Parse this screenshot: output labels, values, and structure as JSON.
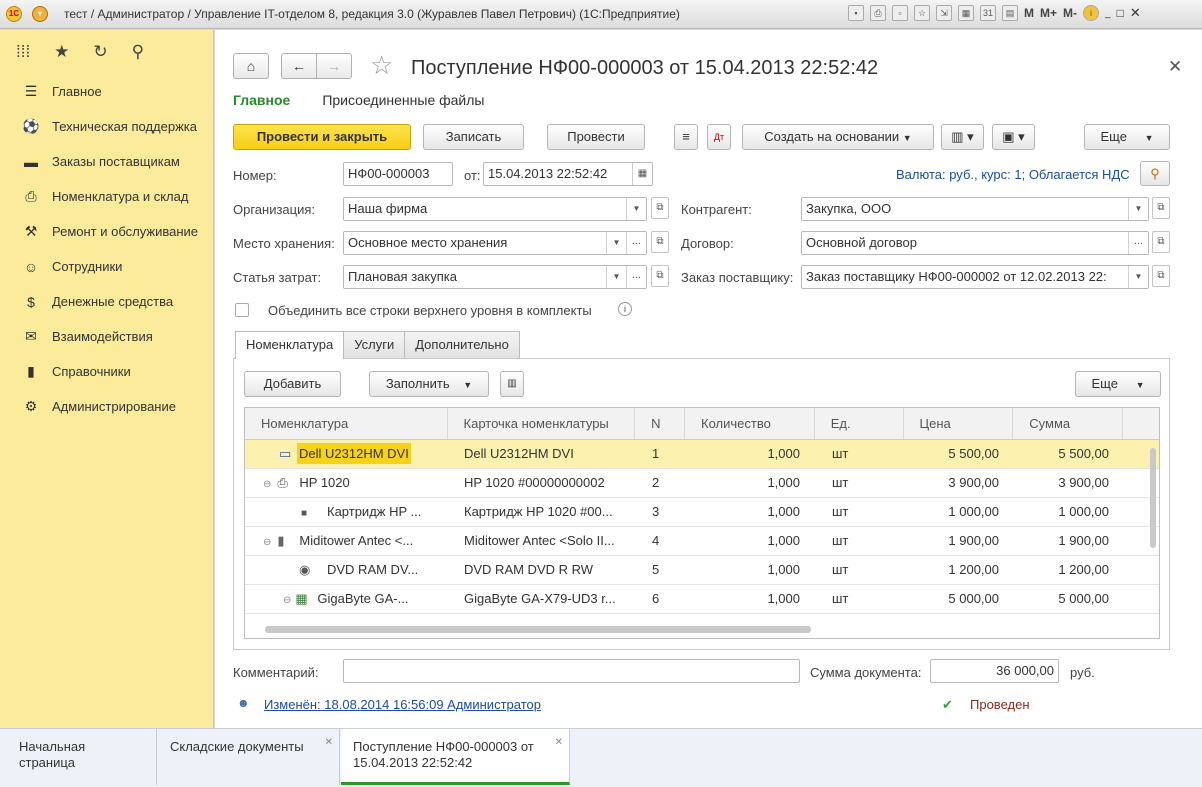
{
  "window": {
    "title": "тест / Администратор / Управление IT-отделом 8, редакция 3.0 (Журавлев Павел Петрович)  (1С:Предприятие)",
    "m_labels": [
      "M",
      "M+",
      "M-"
    ]
  },
  "sidebar": {
    "items": [
      {
        "label": "Главное",
        "icon": "menu-icon"
      },
      {
        "label": "Техническая поддержка",
        "icon": "support-icon"
      },
      {
        "label": "Заказы поставщикам",
        "icon": "truck-icon"
      },
      {
        "label": "Номенклатура и склад",
        "icon": "printer-icon"
      },
      {
        "label": "Ремонт и обслуживание",
        "icon": "wrench-icon"
      },
      {
        "label": "Сотрудники",
        "icon": "users-icon"
      },
      {
        "label": "Денежные средства",
        "icon": "money-icon"
      },
      {
        "label": "Взаимодействия",
        "icon": "envelope-icon"
      },
      {
        "label": "Справочники",
        "icon": "book-icon"
      },
      {
        "label": "Администрирование",
        "icon": "gear-icon"
      }
    ]
  },
  "document": {
    "title": "Поступление НФ00-000003 от 15.04.2013 22:52:42",
    "tabs": [
      "Главное",
      "Присоединенные файлы"
    ]
  },
  "toolbar": {
    "post_close": "Провести и закрыть",
    "save": "Записать",
    "post": "Провести",
    "create_based": "Создать на основании",
    "more": "Еще"
  },
  "form": {
    "number_label": "Номер:",
    "number_value": "НФ00-000003",
    "date_label": "от:",
    "date_value": "15.04.2013 22:52:42",
    "currency_link": "Валюта: руб., курс: 1; Облагается НДС",
    "org_label": "Организация:",
    "org_value": "Наша фирма",
    "contractor_label": "Контрагент:",
    "contractor_value": "Закупка, ООО",
    "storage_label": "Место хранения:",
    "storage_value": "Основное место хранения",
    "contract_label": "Договор:",
    "contract_value": "Основной договор",
    "expense_label": "Статья затрат:",
    "expense_value": "Плановая закупка",
    "order_label": "Заказ поставщику:",
    "order_value": "Заказ поставщику НФ00-000002 от 12.02.2013 22:",
    "combine_label": "Объединить все строки верхнего уровня в комплекты"
  },
  "subtabs": [
    "Номенклатура",
    "Услуги",
    "Дополнительно"
  ],
  "table_toolbar": {
    "add": "Добавить",
    "fill": "Заполнить",
    "more": "Еще"
  },
  "table": {
    "columns": [
      "Номенклатура",
      "Карточка номенклатуры",
      "N",
      "Количество",
      "Ед.",
      "Цена",
      "Сумма"
    ],
    "rows": [
      {
        "name": "Dell U2312HM DVI",
        "card": "Dell U2312HM DVI",
        "n": "1",
        "qty": "1,000",
        "unit": "шт",
        "price": "5 500,00",
        "sum": "5 500,00",
        "level": 0,
        "icon": "monitor-icon"
      },
      {
        "name": "HP 1020",
        "card": "HP 1020 #00000000002",
        "n": "2",
        "qty": "1,000",
        "unit": "шт",
        "price": "3 900,00",
        "sum": "3 900,00",
        "level": 0,
        "icon": "printer-icon"
      },
      {
        "name": "Картридж HP ...",
        "card": "Картридж HP 1020 #00...",
        "n": "3",
        "qty": "1,000",
        "unit": "шт",
        "price": "1 000,00",
        "sum": "1 000,00",
        "level": 1,
        "icon": "cartridge-icon"
      },
      {
        "name": "Miditower Antec <...",
        "card": "Miditower Antec <Solo II...",
        "n": "4",
        "qty": "1,000",
        "unit": "шт",
        "price": "1 900,00",
        "sum": "1 900,00",
        "level": 0,
        "icon": "case-icon"
      },
      {
        "name": "DVD RAM DV...",
        "card": "DVD RAM DVD R RW",
        "n": "5",
        "qty": "1,000",
        "unit": "шт",
        "price": "1 200,00",
        "sum": "1 200,00",
        "level": 1,
        "icon": "dvd-icon"
      },
      {
        "name": "GigaByte GA-...",
        "card": "GigaByte GA-X79-UD3 r...",
        "n": "6",
        "qty": "1,000",
        "unit": "шт",
        "price": "5 000,00",
        "sum": "5 000,00",
        "level": 1,
        "icon": "motherboard-icon"
      }
    ]
  },
  "footer": {
    "comment_label": "Комментарий:",
    "comment_value": "",
    "sum_label": "Сумма документа:",
    "sum_value": "36 000,00",
    "currency": "руб.",
    "changed_link": "Изменён: 18.08.2014 16:56:09 Администратор",
    "status": "Проведен"
  },
  "bottom_tabs": [
    {
      "label": "Начальная страница"
    },
    {
      "label": "Складские документы"
    },
    {
      "label": "Поступление НФ00-000003 от 15.04.2013 22:52:42"
    }
  ]
}
